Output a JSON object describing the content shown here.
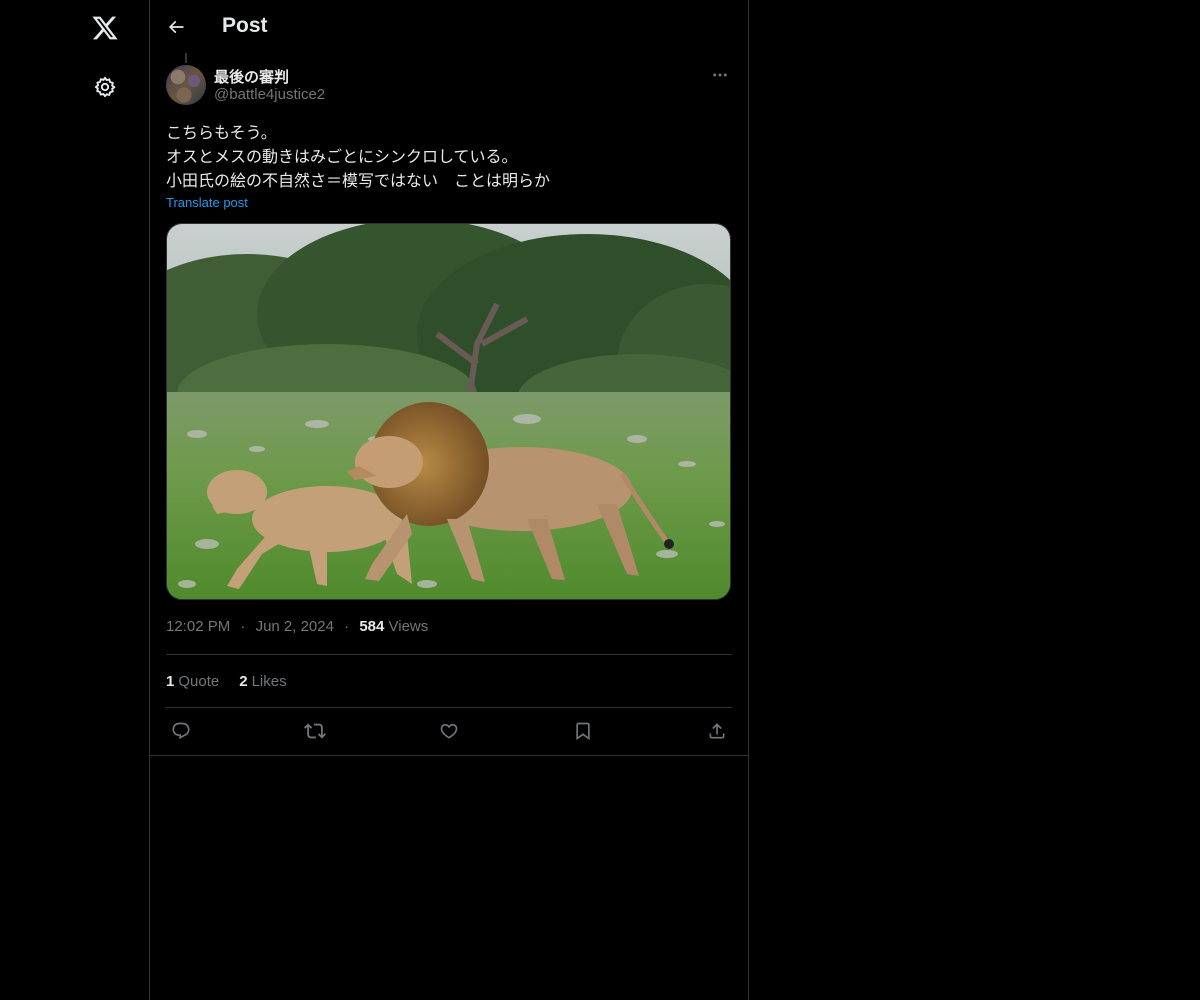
{
  "nav": {
    "logo_icon": "x-logo-icon",
    "settings_icon": "gear-icon"
  },
  "header": {
    "back_icon": "arrow-left-icon",
    "title": "Post"
  },
  "post": {
    "author": {
      "display_name": "最後の審判",
      "handle": "@battle4justice2"
    },
    "more_icon": "ellipsis-icon",
    "text_lines": [
      "こちらもそう。",
      "オスとメスの動きはみごとにシンクロしている。",
      "小田氏の絵の不自然さ＝模写ではない　ことは明らか"
    ],
    "translate_label": "Translate post",
    "media": {
      "description_icon": "photo-lions-icon"
    },
    "time": "12:02 PM",
    "date": "Jun 2, 2024",
    "views_count": "584",
    "views_label": "Views",
    "separator": "·",
    "stats": {
      "quotes_count": "1",
      "quotes_label": "Quote",
      "likes_count": "2",
      "likes_label": "Likes"
    },
    "actions": [
      "reply-icon",
      "repost-icon",
      "like-icon",
      "bookmark-icon",
      "share-icon"
    ]
  },
  "colors": {
    "background": "#000000",
    "text": "#e7e9ea",
    "muted": "#71767b",
    "link": "#1d9bf0",
    "border": "#2f3336"
  }
}
